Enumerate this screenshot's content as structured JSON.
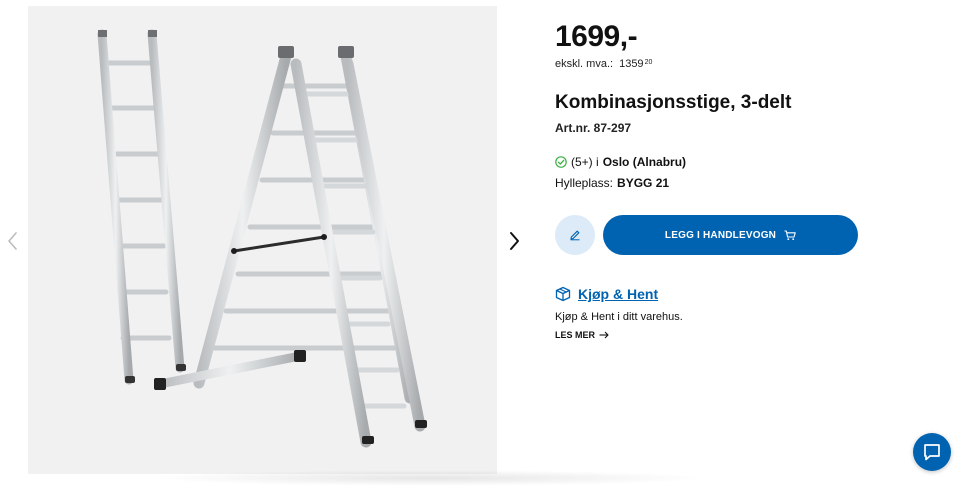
{
  "product": {
    "price": "1699,-",
    "price_ex_label": "ekskl. mva.:",
    "price_ex_main": "1359",
    "price_ex_decimals": "20",
    "title": "Kombinasjonsstige, 3-delt",
    "artnr": "Art.nr. 87-297"
  },
  "stock": {
    "count": "(5+) i",
    "location": "Oslo (Alnabru)",
    "shelf_label": "Hylleplass:",
    "shelf_value": "BYGG 21"
  },
  "actions": {
    "add_to_cart": "LEGG I HANDLEVOGN"
  },
  "click_collect": {
    "link": "Kjøp & Hent",
    "description": "Kjøp & Hent i ditt varehus.",
    "read_more": "LES MER"
  },
  "icons": {
    "check": "check-circle-icon",
    "edit": "pencil-icon",
    "cart": "cart-icon",
    "box": "box-icon",
    "arrow": "arrow-right-icon",
    "chat": "chat-icon",
    "prev": "chevron-left-icon",
    "next": "chevron-right-icon"
  },
  "colors": {
    "primary": "#0063b2",
    "edit_bg": "#dcebf7",
    "stock_ok": "#3cb043"
  }
}
